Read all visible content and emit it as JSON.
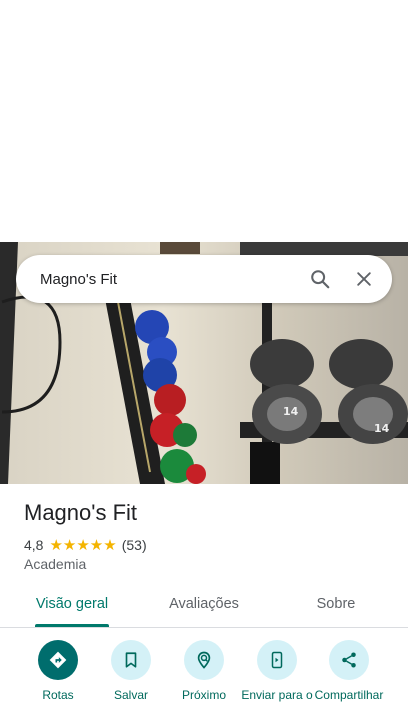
{
  "search": {
    "query": "Magno's Fit"
  },
  "place": {
    "name": "Magno's Fit",
    "rating": "4,8",
    "stars": "★★★★★",
    "reviews_count": "(53)",
    "category": "Academia"
  },
  "tabs": [
    {
      "label": "Visão geral",
      "active": true
    },
    {
      "label": "Avaliações",
      "active": false
    },
    {
      "label": "Sobre",
      "active": false
    }
  ],
  "actions": [
    {
      "label": "Rotas",
      "icon": "directions-icon"
    },
    {
      "label": "Salvar",
      "icon": "bookmark-icon"
    },
    {
      "label": "Próximo",
      "icon": "nearby-icon"
    },
    {
      "label": "Enviar para o",
      "icon": "send-to-phone-icon"
    },
    {
      "label": "Compartilhar",
      "icon": "share-icon"
    }
  ],
  "colors": {
    "accent": "#00796b",
    "primary_button": "#006d6d",
    "chip_bg": "#d4f1f7",
    "star": "#f4b400"
  },
  "dumbbell_labels": [
    "14",
    "14"
  ]
}
